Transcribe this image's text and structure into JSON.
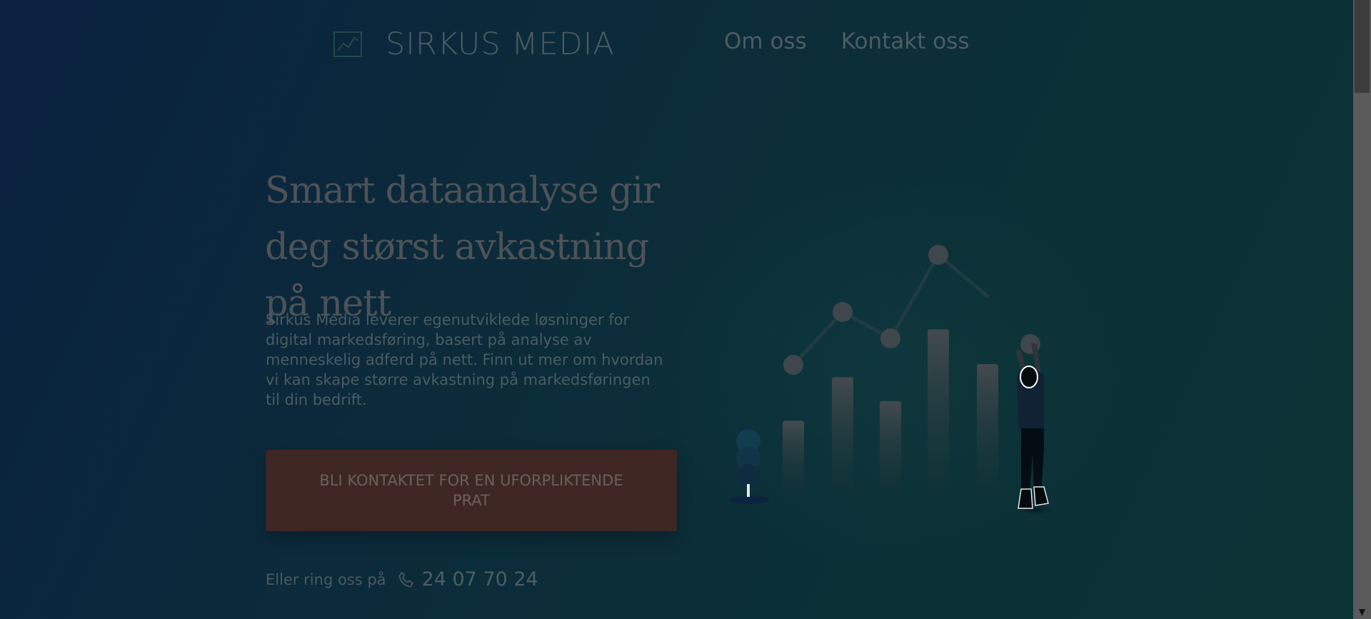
{
  "header": {
    "logo_text": "SIRKUS MEDIA",
    "logo_icon": "chart-frame-icon",
    "nav": [
      {
        "label": "Om oss"
      },
      {
        "label": "Kontakt oss"
      }
    ]
  },
  "hero": {
    "headline": "Smart dataanalyse gir deg størst avkastning på nett",
    "lead": "Sirkus Media leverer egenutviklede løsninger for digital markedsføring, basert på analyse av menneskelig adferd på nett. Finn ut mer om hvordan vi kan skape større avkastning på markedsføringen til din bedrift.",
    "cta_label": "BLI KONTAKTET FOR EN UFORPLIKTENDE PRAT",
    "phone_label": "Eller ring oss på",
    "phone_icon": "phone-icon",
    "phone_number": "24 07 70 24"
  },
  "illustration": {
    "name": "growth-chart-illustration",
    "bar_levels": [
      0.33,
      0.53,
      0.42,
      0.75,
      0.59
    ]
  },
  "colors": {
    "background_dark": "#0a2140",
    "background_teal": "#0b3335",
    "cta_background": "#3e2723",
    "text_muted": "#4d5c61"
  },
  "scrollbar": {
    "arrow_icon": "chevron-down-icon"
  }
}
